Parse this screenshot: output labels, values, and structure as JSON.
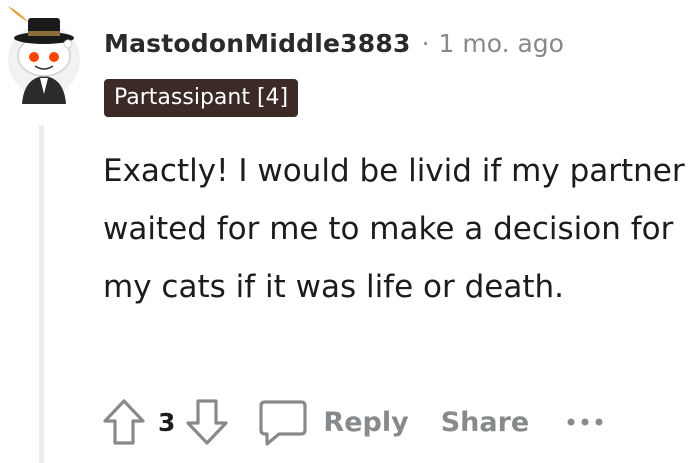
{
  "comment": {
    "author": "MastodonMiddle3883",
    "separator": "·",
    "timestamp": "1 mo. ago",
    "flair": "Partassipant [4]",
    "body": "Exactly! I would be livid if my partner waited for me to make a decision for my cats if it was life or death.",
    "score": "3"
  },
  "actions": {
    "reply_label": "Reply",
    "share_label": "Share"
  },
  "icons": {
    "avatar": "snoo-avatar-icon",
    "upvote": "arrow-up-icon",
    "downvote": "arrow-down-icon",
    "reply": "speech-bubble-icon",
    "more": "more-options-icon"
  },
  "colors": {
    "flair_bg": "#3b2a26",
    "muted_text": "#878a8c",
    "thread_line": "#ececec"
  }
}
